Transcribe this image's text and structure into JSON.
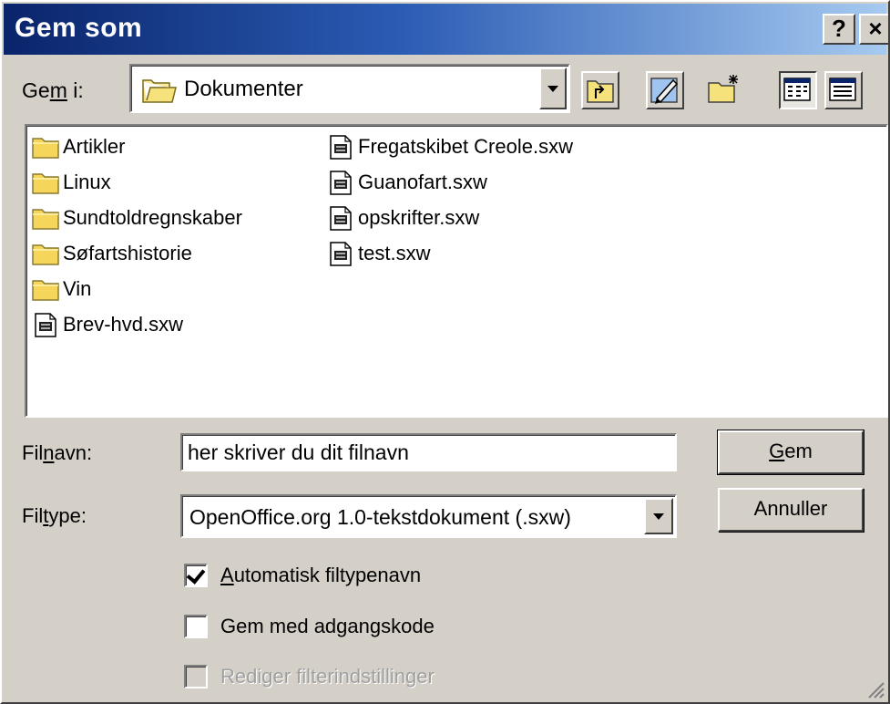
{
  "window": {
    "title": "Gem som",
    "help_glyph": "?",
    "close_glyph": "×"
  },
  "save_in": {
    "label_pre": "Ge",
    "label_u": "m",
    "label_post": " i:",
    "location": "Dokumenter"
  },
  "toolbar": {
    "icons": [
      "folder-up-icon",
      "edit-icon",
      "new-folder-icon",
      "list-view-icon",
      "details-view-icon"
    ]
  },
  "files": {
    "column1": [
      {
        "name": "Artikler",
        "type": "folder"
      },
      {
        "name": "Linux",
        "type": "folder"
      },
      {
        "name": "Sundtoldregnskaber",
        "type": "folder"
      },
      {
        "name": "Søfartshistorie",
        "type": "folder"
      },
      {
        "name": "Vin",
        "type": "folder"
      },
      {
        "name": "Brev-hvd.sxw",
        "type": "document"
      }
    ],
    "column2": [
      {
        "name": "Fregatskibet Creole.sxw",
        "type": "document"
      },
      {
        "name": "Guanofart.sxw",
        "type": "document"
      },
      {
        "name": "opskrifter.sxw",
        "type": "document"
      },
      {
        "name": "test.sxw",
        "type": "document"
      }
    ]
  },
  "filename": {
    "label_pre": "Fil",
    "label_u": "n",
    "label_post": "avn:",
    "value": "her skriver du dit filnavn"
  },
  "filetype": {
    "label_pre": "Fil",
    "label_u": "t",
    "label_post": "ype:",
    "value": "OpenOffice.org 1.0-tekstdokument (.sxw)"
  },
  "buttons": {
    "save": "Gem",
    "cancel": "Annuller"
  },
  "options": {
    "auto_extension": {
      "label": "Automatisk filtypenavn",
      "checked": true
    },
    "password": {
      "label": "Gem med adgangskode",
      "checked": false
    },
    "filter_settings": {
      "label": "Rediger filterindstillinger",
      "checked": false,
      "disabled": true
    }
  },
  "colors": {
    "title_start": "#0a246a",
    "title_end": "#a6caf0",
    "face": "#d4d0c8",
    "folder_yellow": "#f5d65a"
  }
}
